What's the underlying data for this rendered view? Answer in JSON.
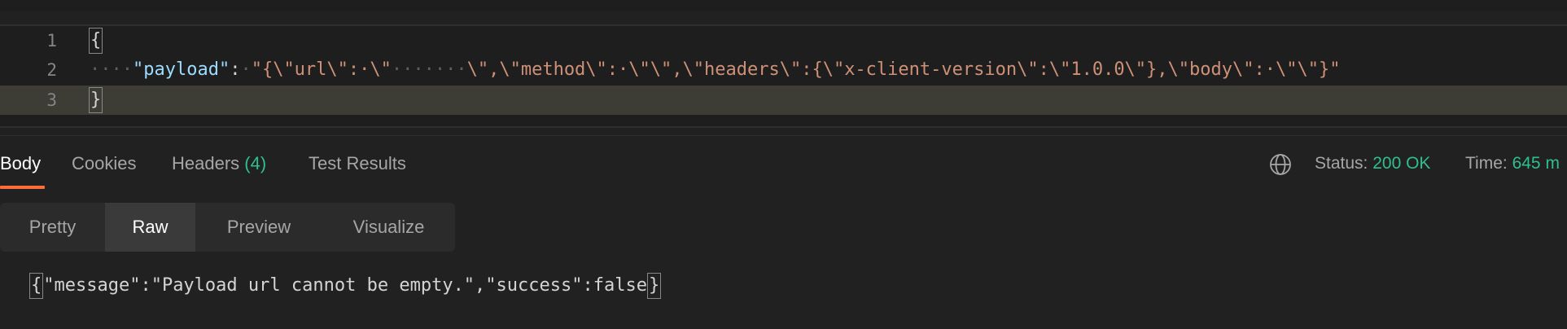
{
  "editor": {
    "lines": [
      {
        "number": "1",
        "text": "{"
      },
      {
        "number": "2",
        "indent": "····",
        "key": "\"payload\"",
        "colon": ":",
        "space": "·",
        "value_before_url": "\"{\\\"url\\\":·\\\"",
        "url_placeholder": "·······",
        "value_after_url": "\\\",\\\"method\\\":·\\\"\\\",\\\"headers\\\":{\\\"x-client-version\\\":\\\"1.0.0\\\"},\\\"body\\\":·\\\"\\\"}\""
      },
      {
        "number": "3",
        "text": "}"
      }
    ]
  },
  "response": {
    "tabs": [
      {
        "label": "Body",
        "active": true
      },
      {
        "label": "Cookies",
        "active": false
      },
      {
        "label": "Headers",
        "count": "(4)",
        "active": false
      },
      {
        "label": "Test Results",
        "active": false
      }
    ],
    "network_icon": "globe-icon",
    "status_label": "Status:",
    "status_value": "200 OK",
    "time_label": "Time:",
    "time_value": "645 m",
    "formats": [
      {
        "label": "Pretty",
        "active": false
      },
      {
        "label": "Raw",
        "active": true
      },
      {
        "label": "Preview",
        "active": false
      },
      {
        "label": "Visualize",
        "active": false
      }
    ],
    "body": {
      "open_brace": "{",
      "content": "\"message\":\"Payload url cannot be empty.\",\"success\":false",
      "close_brace": "}"
    }
  },
  "colors": {
    "background": "#212121",
    "editor_background": "#1e1e1e",
    "active_line": "#3d3d35",
    "accent_orange": "#ff6c37",
    "success_green": "#2fbf8f",
    "json_key": "#9cdcfe",
    "json_string": "#ce9178"
  }
}
